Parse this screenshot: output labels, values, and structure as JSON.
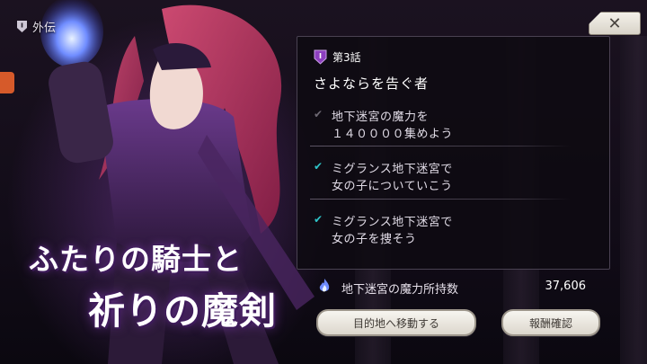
{
  "header": {
    "side_story_label": "外伝"
  },
  "title_art": {
    "line1": "ふたりの騎士と",
    "line2": "祈りの魔剣"
  },
  "close_button": {
    "label": "✕"
  },
  "panel": {
    "chapter_label": "第3話",
    "quest_title": "さよならを告ぐ者",
    "tasks": [
      {
        "line1": "地下迷宮の魔力を",
        "line2": "１４００００集めよう",
        "done": false
      },
      {
        "line1": "ミグランス地下迷宮で",
        "line2": "女の子についていこう",
        "done": true
      },
      {
        "line1": "ミグランス地下迷宮で",
        "line2": "女の子を捜そう",
        "done": true
      }
    ],
    "mana": {
      "label": "地下迷宮の魔力所持数",
      "value": "37,606"
    },
    "buttons": {
      "move": "目的地へ移動する",
      "reward": "報酬確認"
    }
  },
  "colors": {
    "check_done": "#2ec4c8",
    "accent_purple": "#7a3aa8",
    "side_tab": "#d65a2a"
  },
  "icons": {
    "side_story": "shield-icon",
    "chapter": "chapter-badge-icon",
    "mana": "flame-icon",
    "check": "check-icon"
  }
}
